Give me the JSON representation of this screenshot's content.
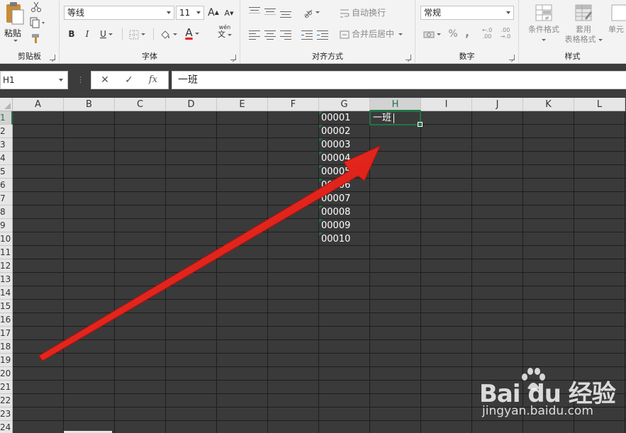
{
  "ribbon": {
    "clipboard": {
      "title": "剪贴板",
      "paste_label": "粘贴"
    },
    "font": {
      "title": "字体",
      "font_name": "等线",
      "font_size": "11",
      "bold": "B",
      "italic": "I",
      "underline": "U",
      "font_color_glyph": "A",
      "phonetic_top": "wén",
      "phonetic_bottom": "文",
      "grow_font": "A",
      "shrink_font": "A"
    },
    "alignment": {
      "title": "对齐方式",
      "wrap_text": "自动换行",
      "merge_center": "合并后居中"
    },
    "number": {
      "title": "数字",
      "format": "常规",
      "percent": "%",
      "comma": ",",
      "inc_decimal": "←.0 .00",
      "dec_decimal": ".00 →.0"
    },
    "styles": {
      "title": "样式",
      "conditional_format": "条件格式",
      "format_table_line1": "套用",
      "format_table_line2": "表格格式",
      "cell_styles": "单元"
    }
  },
  "formula_bar": {
    "name_box": "H1",
    "cancel": "✕",
    "enter": "✓",
    "fx": "fx",
    "content": "一班"
  },
  "grid": {
    "columns": [
      "A",
      "B",
      "C",
      "D",
      "E",
      "F",
      "G",
      "H",
      "I",
      "J",
      "K",
      "L"
    ],
    "selected_column": "H",
    "rows": [
      "1",
      "2",
      "3",
      "4",
      "5",
      "6",
      "7",
      "8",
      "9",
      "10",
      "11",
      "12",
      "13",
      "14",
      "15",
      "16",
      "17",
      "18",
      "19",
      "20",
      "21",
      "22",
      "23",
      "24"
    ],
    "selected_row": "1",
    "column_g_values": [
      "00001",
      "00002",
      "00003",
      "00004",
      "00005",
      "00006",
      "00007",
      "00008",
      "00009",
      "00010"
    ],
    "active_cell_text": "一班"
  },
  "colors": {
    "accent": "#217346",
    "arrow": "#e8130f",
    "cell_bg": "#3a3a3a",
    "gridline": "#1e1e1e"
  },
  "watermark": {
    "brand": "Bai du 经验",
    "url": "jingyan.baidu.com"
  }
}
